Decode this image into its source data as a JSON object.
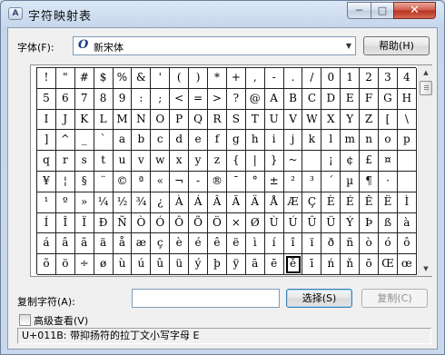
{
  "window": {
    "title": "字符映射表",
    "icon": "app-icon",
    "min_label": "─",
    "max_label": "□",
    "close_label": "✕"
  },
  "font": {
    "label": "字体(F):",
    "value": "新宋体",
    "font_type_icon": "O",
    "help_label": "帮助(H)"
  },
  "characters": [
    [
      "!",
      "\"",
      "#",
      "$",
      "%",
      "&",
      "'",
      "(",
      ")",
      "*",
      "+",
      ",",
      "-",
      ".",
      "/",
      "0",
      "1",
      "2",
      "3",
      "4"
    ],
    [
      "5",
      "6",
      "7",
      "8",
      "9",
      ":",
      ";",
      "<",
      "=",
      ">",
      "?",
      "@",
      "A",
      "B",
      "C",
      "D",
      "E",
      "F",
      "G",
      "H"
    ],
    [
      "I",
      "J",
      "K",
      "L",
      "M",
      "N",
      "O",
      "P",
      "Q",
      "R",
      "S",
      "T",
      "U",
      "V",
      "W",
      "X",
      "Y",
      "Z",
      "[",
      "\\"
    ],
    [
      "]",
      "^",
      "_",
      "`",
      "a",
      "b",
      "c",
      "d",
      "e",
      "f",
      "g",
      "h",
      "i",
      "j",
      "k",
      "l",
      "m",
      "n",
      "o",
      "p"
    ],
    [
      "q",
      "r",
      "s",
      "t",
      "u",
      "v",
      "w",
      "x",
      "y",
      "z",
      "{",
      "|",
      "}",
      "~",
      "",
      "¡",
      "¢",
      "£",
      "¤",
      ""
    ],
    [
      "¥",
      "¦",
      "§",
      "¨",
      "©",
      "ª",
      "«",
      "¬",
      "-",
      "®",
      "¯",
      "°",
      "±",
      "²",
      "³",
      "´",
      "µ",
      "¶",
      "·",
      ""
    ],
    [
      "¹",
      "º",
      "»",
      "¼",
      "½",
      "¾",
      "¿",
      "À",
      "Á",
      "Â",
      "Ã",
      "Ä",
      "Å",
      "Æ",
      "Ç",
      "È",
      "É",
      "Ê",
      "Ë",
      "Ì"
    ],
    [
      "Í",
      "Î",
      "Ï",
      "Ð",
      "Ñ",
      "Ò",
      "Ó",
      "Ô",
      "Õ",
      "Ö",
      "×",
      "Ø",
      "Ù",
      "Ú",
      "Û",
      "Ü",
      "Ý",
      "Þ",
      "ß",
      "à"
    ],
    [
      "á",
      "â",
      "ã",
      "ä",
      "å",
      "æ",
      "ç",
      "è",
      "é",
      "ê",
      "ë",
      "ì",
      "í",
      "î",
      "ï",
      "ð",
      "ñ",
      "ò",
      "ó",
      "ô"
    ],
    [
      "õ",
      "ö",
      "÷",
      "ø",
      "ù",
      "ú",
      "û",
      "ü",
      "ý",
      "þ",
      "ÿ",
      "ā",
      "ē",
      "ě",
      "ī",
      "ń",
      "ň",
      "ō",
      "Œ",
      "œ"
    ]
  ],
  "selected_cell": {
    "row": 9,
    "col": 13
  },
  "scrollbar": {
    "up_arrow": "▲",
    "down_arrow": "▼"
  },
  "copy": {
    "label": "复制字符(A):",
    "value": "",
    "select_label": "选择(S)",
    "copy_label": "复制(C)"
  },
  "advanced": {
    "label": "高级查看(V)",
    "checked": false
  },
  "status": {
    "text": "U+011B: 带抑扬符的拉丁文小写字母 E"
  }
}
